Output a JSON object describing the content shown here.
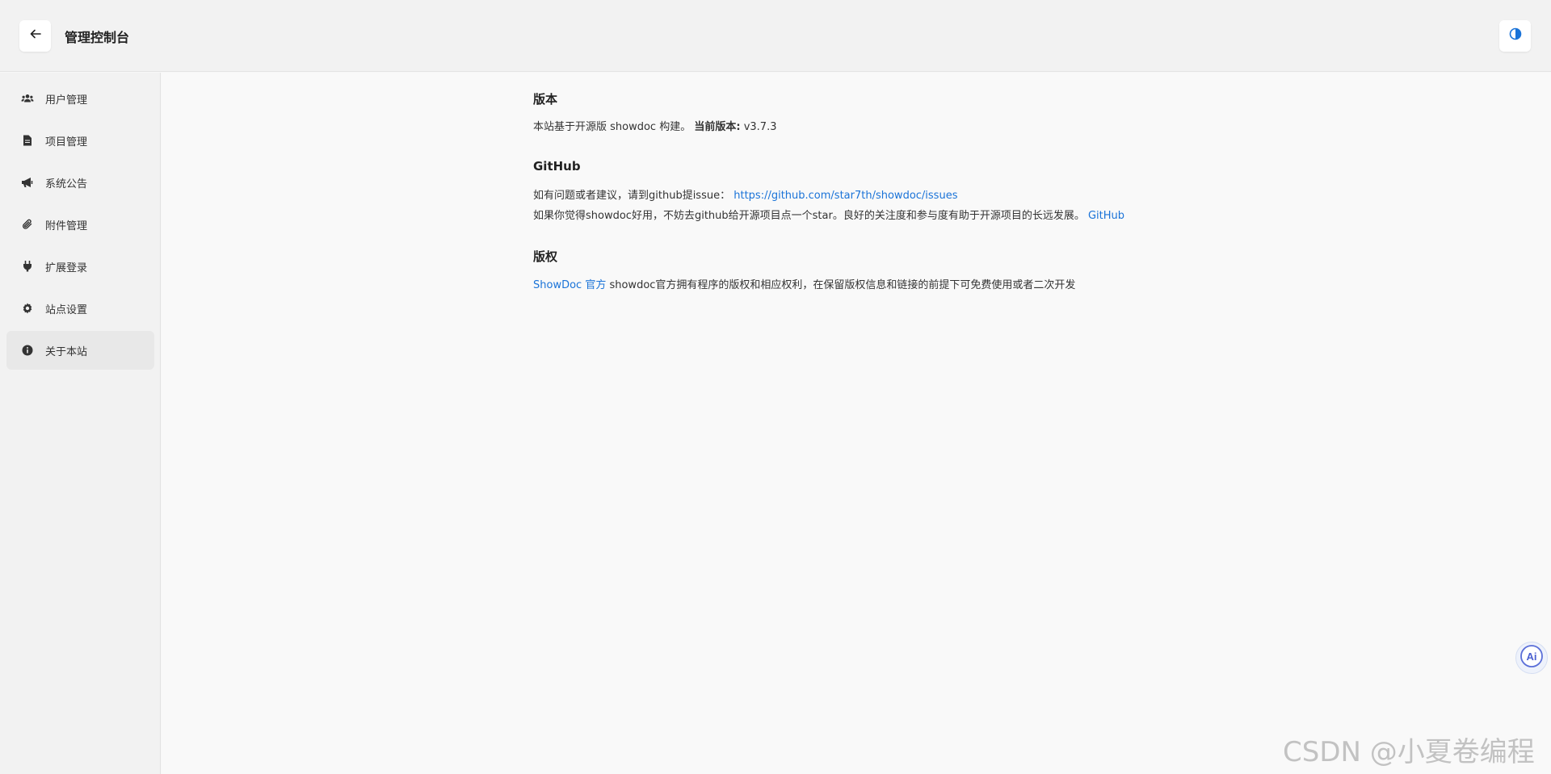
{
  "header": {
    "title": "管理控制台",
    "back_icon": "arrow-left-icon",
    "theme_icon": "contrast-icon"
  },
  "sidebar": {
    "items": [
      {
        "label": "用户管理",
        "icon": "users-icon"
      },
      {
        "label": "项目管理",
        "icon": "file-icon"
      },
      {
        "label": "系统公告",
        "icon": "megaphone-icon"
      },
      {
        "label": "附件管理",
        "icon": "paperclip-icon"
      },
      {
        "label": "扩展登录",
        "icon": "plug-icon"
      },
      {
        "label": "站点设置",
        "icon": "gear-icon"
      },
      {
        "label": "关于本站",
        "icon": "info-icon",
        "active": true
      }
    ]
  },
  "about": {
    "version": {
      "title": "版本",
      "text": "本站基于开源版 showdoc 构建。",
      "current_label": "当前版本:",
      "current_value": "v3.7.3"
    },
    "github": {
      "title": "GitHub",
      "line1_text": "如有问题或者建议，请到github提issue：",
      "line1_link": "https://github.com/star7th/showdoc/issues",
      "line2_text": "如果你觉得showdoc好用，不妨去github给开源项目点一个star。良好的关注度和参与度有助于开源项目的长远发展。",
      "line2_link": "GitHub"
    },
    "copyright": {
      "title": "版权",
      "link": "ShowDoc 官方",
      "text": "showdoc官方拥有程序的版权和相应权利，在保留版权信息和链接的前提下可免费使用或者二次开发"
    }
  },
  "ai_button": {
    "label": "Ai"
  },
  "watermark": "CSDN @小夏卷编程",
  "colors": {
    "link": "#1a73d8",
    "accent": "#1a73d8"
  }
}
